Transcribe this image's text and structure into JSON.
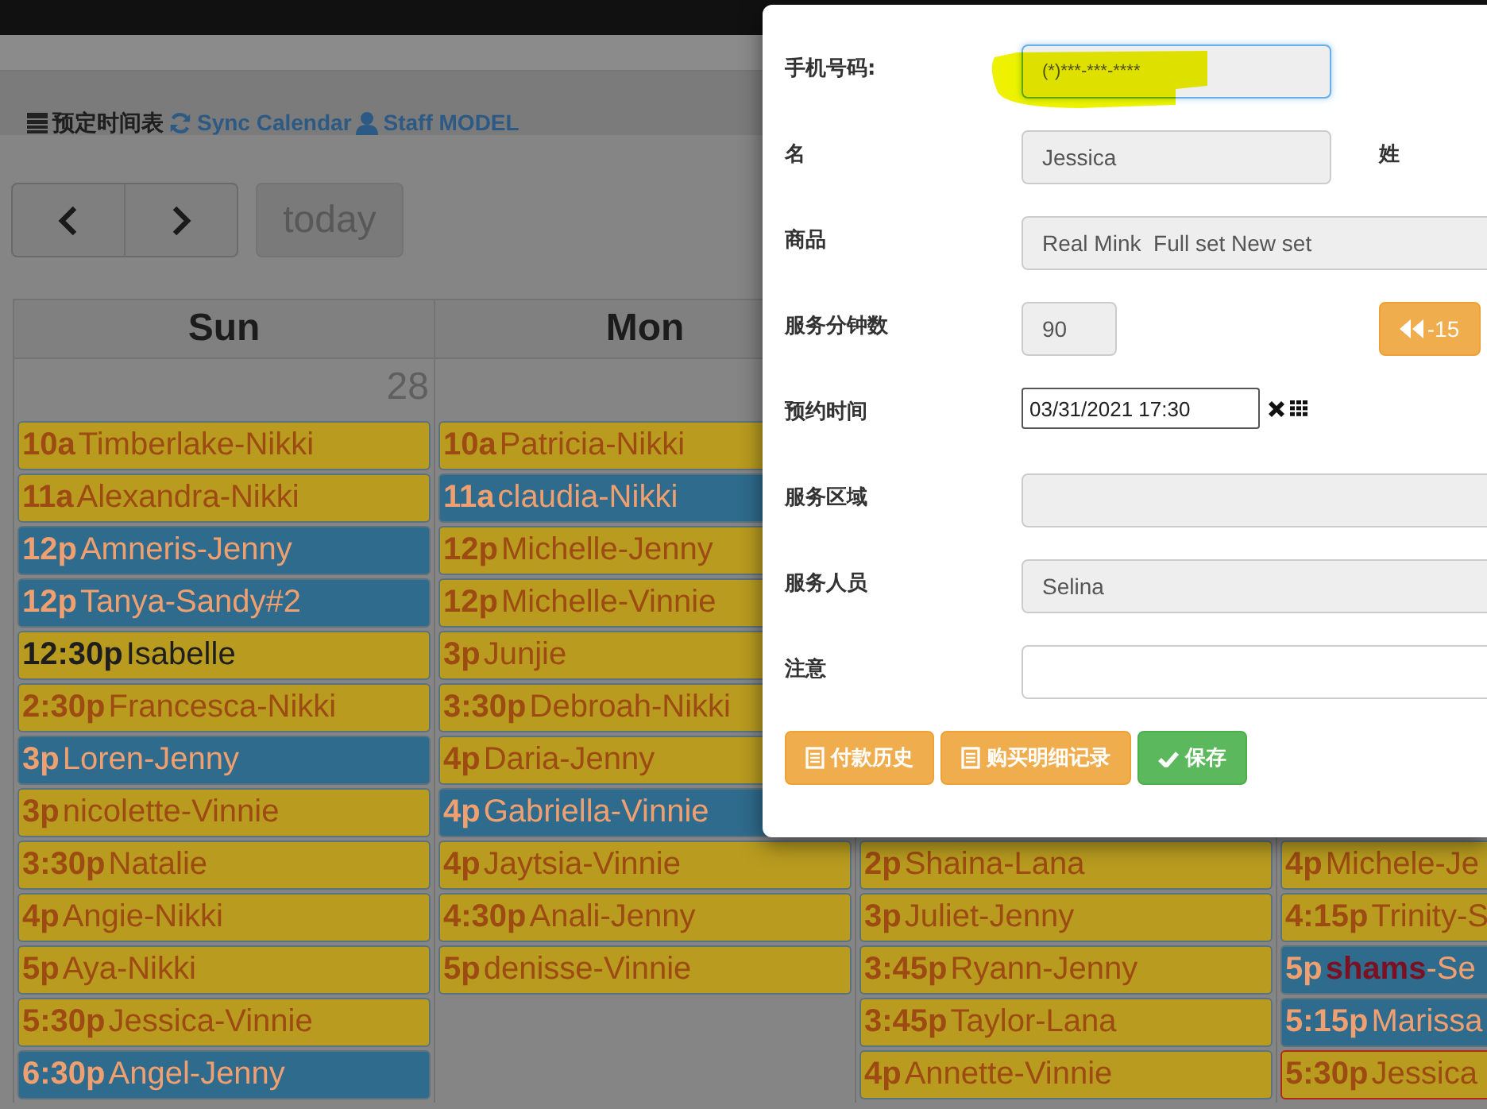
{
  "toolbar": [
    {
      "kind": "title",
      "label": "预定时间表"
    },
    {
      "kind": "sync",
      "label": "Sync Calendar"
    },
    {
      "kind": "staff",
      "label": "Staff MODEL"
    }
  ],
  "navigation": {
    "today": {
      "label": "today",
      "disabled": true
    }
  },
  "calendar": {
    "columns": [
      {
        "day": "Sun",
        "date": "28",
        "events": [
          {
            "time": "10a",
            "title": "Timberlake-Nikki",
            "color": "#b89b1f"
          },
          {
            "time": "11a",
            "title": "Alexandra-Nikki",
            "color": "#b89b1f"
          },
          {
            "time": "12p",
            "title": "Amneris-Jenny",
            "color": "#2f6b8c"
          },
          {
            "time": "12p",
            "title": "Tanya-Sandy#2",
            "color": "#2f6b8c"
          },
          {
            "time": "12:30p",
            "title": "Isabelle",
            "color": "#b89b1f",
            "kind": "dark"
          },
          {
            "time": "2:30p",
            "title": "Francesca-Nikki",
            "color": "#b89b1f"
          },
          {
            "time": "3p",
            "title": "Loren-Jenny",
            "color": "#2f6b8c"
          },
          {
            "time": "3p",
            "title": "nicolette-Vinnie",
            "color": "#b89b1f"
          },
          {
            "time": "3:30p",
            "title": "Natalie",
            "color": "#b89b1f"
          },
          {
            "time": "4p",
            "title": "Angie-Nikki",
            "color": "#b89b1f"
          },
          {
            "time": "5p",
            "title": "Aya-Nikki",
            "color": "#b89b1f"
          },
          {
            "time": "5:30p",
            "title": "Jessica-Vinnie",
            "color": "#b89b1f"
          },
          {
            "time": "6:30p",
            "title": "Angel-Jenny",
            "color": "#2f6b8c"
          }
        ]
      },
      {
        "day": "Mon",
        "events": [
          {
            "time": "10a",
            "title": "Patricia-Nikki",
            "color": "#b89b1f"
          },
          {
            "time": "11a",
            "title": "claudia-Nikki",
            "color": "#2f6b8c"
          },
          {
            "time": "12p",
            "title": "Michelle-Jenny",
            "color": "#b89b1f"
          },
          {
            "time": "12p",
            "title": "Michelle-Vinnie",
            "color": "#b89b1f"
          },
          {
            "time": "3p",
            "title": "Junjie",
            "color": "#b89b1f"
          },
          {
            "time": "3:30p",
            "title": "Debroah-Nikki",
            "color": "#b89b1f"
          },
          {
            "time": "4p",
            "title": "Daria-Jenny",
            "color": "#b89b1f"
          },
          {
            "time": "4p",
            "title": "Gabriella-Vinnie",
            "color": "#2f6b8c"
          },
          {
            "time": "4p",
            "title": "Jaytsia-Vinnie",
            "color": "#b89b1f"
          },
          {
            "time": "4:30p",
            "title": "Anali-Jenny",
            "color": "#b89b1f"
          },
          {
            "time": "5p",
            "title": "denisse-Vinnie",
            "color": "#b89b1f"
          }
        ]
      },
      {
        "events": [
          {
            "time": "2p",
            "title": "Shaina-Lana",
            "color": "#b89b1f"
          },
          {
            "time": "3p",
            "title": "Juliet-Jenny",
            "color": "#b89b1f"
          },
          {
            "time": "3:45p",
            "title": "Ryann-Jenny",
            "color": "#b89b1f"
          },
          {
            "time": "3:45p",
            "title": "Taylor-Lana",
            "color": "#b89b1f"
          },
          {
            "time": "4p",
            "title": "Annette-Vinnie",
            "color": "#b89b1f"
          }
        ]
      },
      {
        "events": [
          {
            "time": "4p",
            "title": "Michele-Je",
            "color": "#b89b1f"
          },
          {
            "time": "4:15p",
            "title": "Trinity-S",
            "color": "#b89b1f"
          },
          {
            "time": "5p",
            "title": "**shams**-Se",
            "color": "#2f6b8c"
          },
          {
            "time": "5:15p",
            "title": "Marissa",
            "color": "#2f6b8c"
          },
          {
            "time": "5:30p",
            "title": "Jessica",
            "color": "#b89b1f",
            "kind": "outlined"
          }
        ]
      }
    ]
  },
  "dialog": {
    "rows": [
      {
        "label": "手机号码:",
        "field": {
          "kind": "focused",
          "value": "(*)***-***-****"
        },
        "highlighted": true
      },
      {
        "label": "名",
        "field": {
          "kind": "readonly",
          "value": "Jessica"
        },
        "side_label": "姓"
      },
      {
        "label": "商品",
        "field": {
          "kind": "wide",
          "value": "Real Mink  Full set New set"
        }
      },
      {
        "label": "服务分钟数",
        "field": {
          "kind": "short",
          "value": "90"
        },
        "button": "-15"
      },
      {
        "label": "预约时间",
        "field": {
          "kind": "datetime",
          "value": "03/31/2021 17:30"
        }
      },
      {
        "label": "服务区域",
        "field": {
          "kind": "wide"
        }
      },
      {
        "label": "服务人员",
        "field": {
          "kind": "wide",
          "value": "Selina"
        }
      },
      {
        "label": "注意",
        "field": {
          "kind": "input"
        }
      }
    ],
    "buttons": [
      {
        "label": "付款历史",
        "kind": "list"
      },
      {
        "label": "购买明细记录",
        "kind": "list"
      },
      {
        "label": "保存",
        "kind": "save"
      }
    ]
  }
}
